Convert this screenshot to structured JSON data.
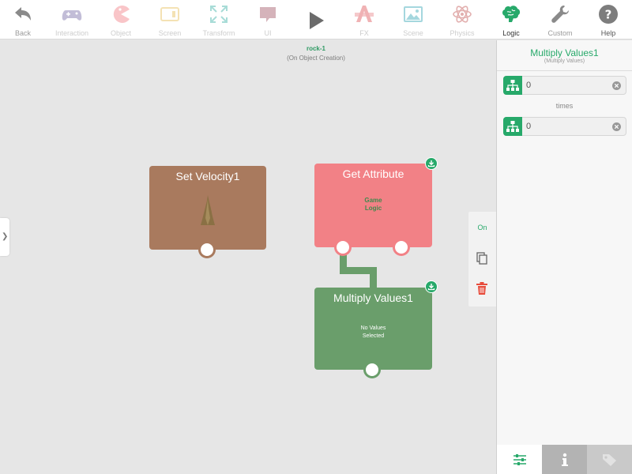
{
  "toolbar": {
    "items": [
      {
        "label": "Back"
      },
      {
        "label": "Interaction"
      },
      {
        "label": "Object"
      },
      {
        "label": "Screen"
      },
      {
        "label": "Transform"
      },
      {
        "label": "UI"
      },
      {
        "label": "FX"
      },
      {
        "label": "Scene"
      },
      {
        "label": "Physics"
      },
      {
        "label": "Logic"
      },
      {
        "label": "Custom"
      },
      {
        "label": "Help"
      }
    ],
    "active": "Logic",
    "play_icon": "play-icon"
  },
  "canvas": {
    "object_name": "rock-1",
    "event": "(On Object Creation)"
  },
  "nodes": {
    "set_velocity": {
      "title": "Set Velocity1"
    },
    "get_attribute": {
      "title": "Get Attribute",
      "body_line1": "Game",
      "body_line2": "Logic"
    },
    "multiply_values": {
      "title": "Multiply Values1",
      "body_line1": "No Values",
      "body_line2": "Selected"
    }
  },
  "actions": {
    "toggle_label": "On",
    "copy_icon": "copy-icon",
    "delete_icon": "trash-icon"
  },
  "panel": {
    "title": "Multiply Values1",
    "subtitle": "(Multiply Values)",
    "field1": {
      "value": "0"
    },
    "separator": "times",
    "field2": {
      "value": "0"
    }
  },
  "colors": {
    "accent": "#27a96a",
    "node_brown": "#a97a5e",
    "node_red": "#f28186",
    "node_green": "#6a9e6b",
    "delete": "#e74c3c"
  }
}
